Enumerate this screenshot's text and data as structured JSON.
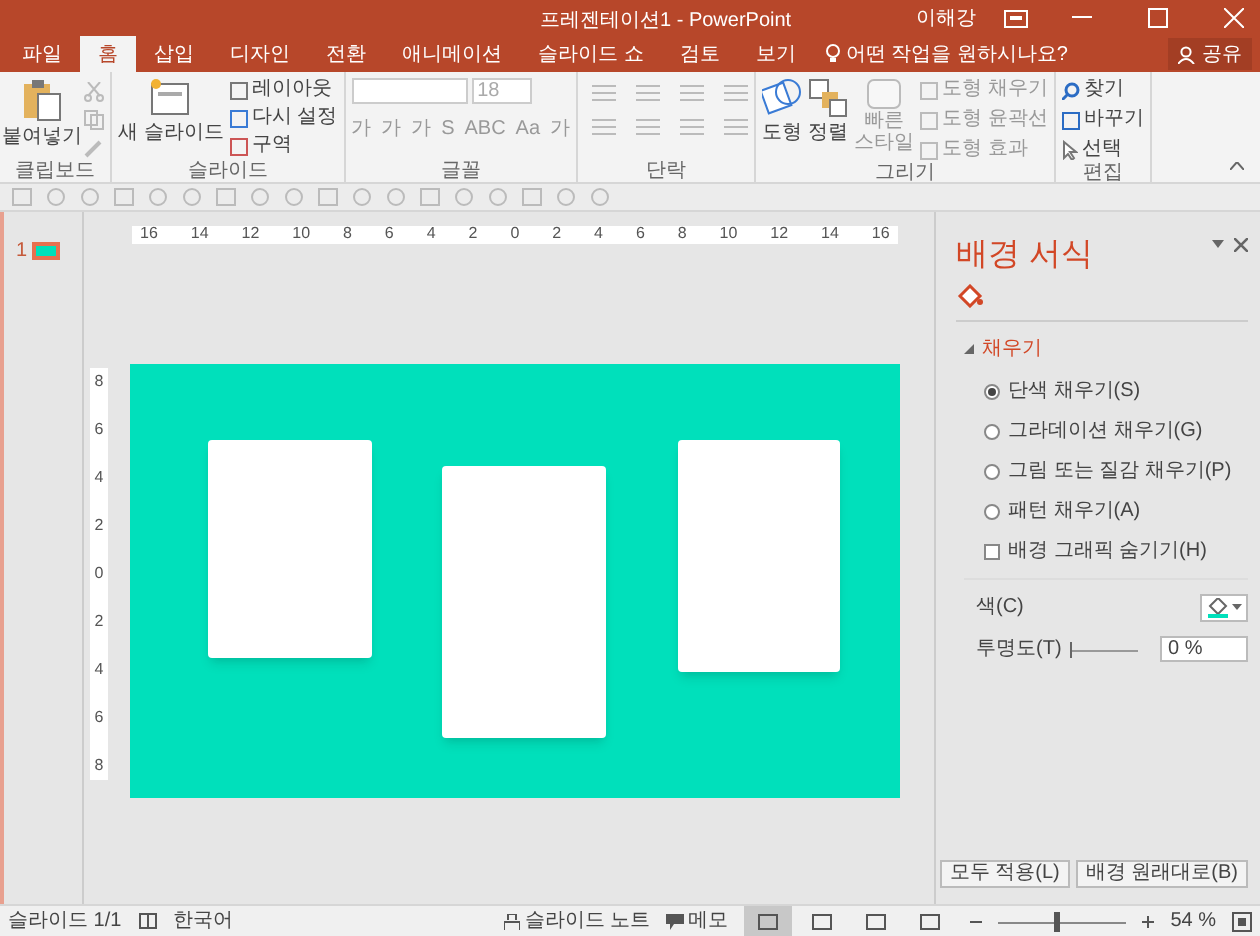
{
  "window": {
    "title": "프레젠테이션1 - PowerPoint",
    "user": "이해강"
  },
  "tabs": [
    {
      "label": "파일",
      "selected": false
    },
    {
      "label": "홈",
      "selected": true
    },
    {
      "label": "삽입",
      "selected": false
    },
    {
      "label": "디자인",
      "selected": false
    },
    {
      "label": "전환",
      "selected": false
    },
    {
      "label": "애니메이션",
      "selected": false
    },
    {
      "label": "슬라이드 쇼",
      "selected": false
    },
    {
      "label": "검토",
      "selected": false
    },
    {
      "label": "보기",
      "selected": false
    }
  ],
  "tell_me": "어떤 작업을 원하시나요?",
  "share": "공유",
  "ribbon": {
    "paste": "붙여넣기",
    "new_slide": "새 슬라이드",
    "layout": "레이아웃",
    "reset": "다시 설정",
    "section": "구역",
    "font_size": "18",
    "font_buttons": [
      "가",
      "가",
      "가",
      "S",
      "ABC",
      "Aa",
      "가"
    ],
    "shapes": "도형",
    "arrange": "정렬",
    "quick_styles": [
      "빠른",
      "스타일"
    ],
    "shape_fill": "도형 채우기",
    "shape_outline": "도형 윤곽선",
    "shape_effects": "도형 효과",
    "find": "찾기",
    "replace": "바꾸기",
    "select": "선택",
    "groups": [
      "클립보드",
      "슬라이드",
      "글꼴",
      "단락",
      "그리기",
      "편집"
    ]
  },
  "thumbnails": [
    {
      "number": "1",
      "selected": true
    }
  ],
  "ruler": [
    "16",
    "14",
    "12",
    "10",
    "8",
    "6",
    "4",
    "2",
    "0",
    "2",
    "4",
    "6",
    "8",
    "10",
    "12",
    "14",
    "16"
  ],
  "vertical_ruler": [
    "8",
    "6",
    "4",
    "2",
    "0",
    "2",
    "4",
    "6",
    "8"
  ],
  "format_pane": {
    "title": "배경 서식",
    "section": {
      "label": "채우기",
      "expanded": true
    },
    "options": [
      {
        "label": "단색 채우기(S)",
        "selected": true
      },
      {
        "label": "그라데이션 채우기(G)",
        "selected": false
      },
      {
        "label": "그림 또는 질감 채우기(P)",
        "selected": false
      },
      {
        "label": "패턴 채우기(A)",
        "selected": false
      }
    ],
    "hide_graphics": {
      "label": "배경 그래픽 숨기기(H)",
      "checked": false
    },
    "color_label": "색(C)",
    "transparency": {
      "label": "투명도(T)",
      "level": 0,
      "value": "0 %"
    },
    "buttons": [
      "모두 적용(L)",
      "배경 원래대로(B)"
    ]
  },
  "status_bar": {
    "slide": "슬라이드 1/1",
    "language": "한국어",
    "notes": "슬라이드 노트",
    "comments": "메모",
    "zoom": "54 %",
    "zoom_slider": {
      "level": 0.45
    },
    "views": [
      {
        "selected": true
      },
      {
        "selected": false
      },
      {
        "selected": false
      },
      {
        "selected": false
      }
    ]
  }
}
